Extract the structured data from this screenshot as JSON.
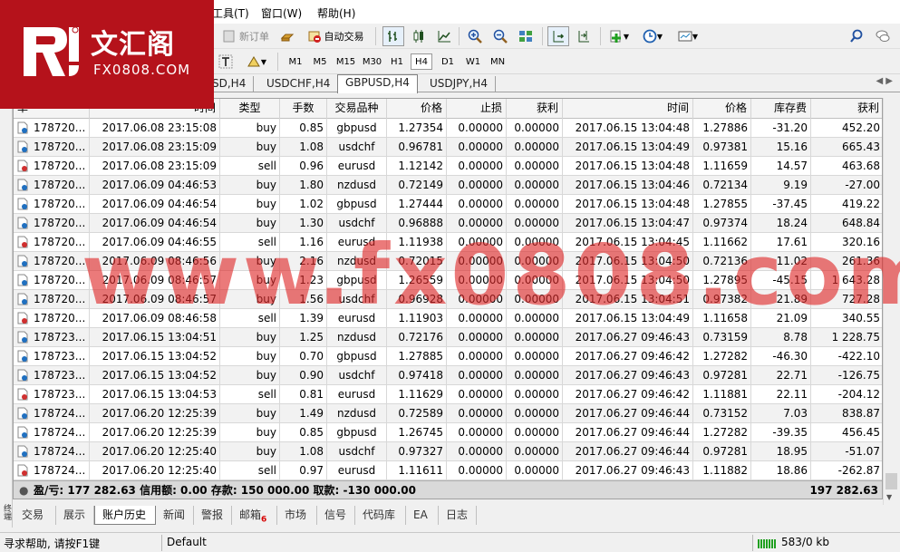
{
  "menu": [
    "工具(T)",
    "窗口(W)",
    "帮助(H)"
  ],
  "toolbar": {
    "new_order": "新订单",
    "auto_trading": "自动交易"
  },
  "timeframes": [
    "M1",
    "M5",
    "M15",
    "M30",
    "H1",
    "H4",
    "D1",
    "W1",
    "MN"
  ],
  "active_timeframe": "H4",
  "logo": {
    "cn": "文汇阁",
    "en": "FX0808.COM"
  },
  "chart_tabs": [
    "SD,H4",
    "USDCHF,H4",
    "GBPUSD,H4",
    "USDJPY,H4"
  ],
  "active_chart_tab": "GBPUSD,H4",
  "table": {
    "headers": [
      "单",
      "时间",
      "类型",
      "手数",
      "交易品种",
      "价格",
      "止损",
      "获利",
      "时间",
      "价格",
      "库存费",
      "获利"
    ],
    "rows": [
      [
        "178720...",
        "2017.06.08 23:15:08",
        "buy",
        "0.85",
        "gbpusd",
        "1.27354",
        "0.00000",
        "0.00000",
        "2017.06.15 13:04:48",
        "1.27886",
        "-31.20",
        "452.20"
      ],
      [
        "178720...",
        "2017.06.08 23:15:09",
        "buy",
        "1.08",
        "usdchf",
        "0.96781",
        "0.00000",
        "0.00000",
        "2017.06.15 13:04:49",
        "0.97381",
        "15.16",
        "665.43"
      ],
      [
        "178720...",
        "2017.06.08 23:15:09",
        "sell",
        "0.96",
        "eurusd",
        "1.12142",
        "0.00000",
        "0.00000",
        "2017.06.15 13:04:48",
        "1.11659",
        "14.57",
        "463.68"
      ],
      [
        "178720...",
        "2017.06.09 04:46:53",
        "buy",
        "1.80",
        "nzdusd",
        "0.72149",
        "0.00000",
        "0.00000",
        "2017.06.15 13:04:46",
        "0.72134",
        "9.19",
        "-27.00"
      ],
      [
        "178720...",
        "2017.06.09 04:46:54",
        "buy",
        "1.02",
        "gbpusd",
        "1.27444",
        "0.00000",
        "0.00000",
        "2017.06.15 13:04:48",
        "1.27855",
        "-37.45",
        "419.22"
      ],
      [
        "178720...",
        "2017.06.09 04:46:54",
        "buy",
        "1.30",
        "usdchf",
        "0.96888",
        "0.00000",
        "0.00000",
        "2017.06.15 13:04:47",
        "0.97374",
        "18.24",
        "648.84"
      ],
      [
        "178720...",
        "2017.06.09 04:46:55",
        "sell",
        "1.16",
        "eurusd",
        "1.11938",
        "0.00000",
        "0.00000",
        "2017.06.15 13:04:45",
        "1.11662",
        "17.61",
        "320.16"
      ],
      [
        "178720...",
        "2017.06.09 08:46:56",
        "buy",
        "2.16",
        "nzdusd",
        "0.72015",
        "0.00000",
        "0.00000",
        "2017.06.15 13:04:50",
        "0.72136",
        "11.02",
        "261.36"
      ],
      [
        "178720...",
        "2017.06.09 08:46:57",
        "buy",
        "1.23",
        "gbpusd",
        "1.26559",
        "0.00000",
        "0.00000",
        "2017.06.15 13:04:50",
        "1.27895",
        "-45.15",
        "1 643.28"
      ],
      [
        "178720...",
        "2017.06.09 08:46:57",
        "buy",
        "1.56",
        "usdchf",
        "0.96928",
        "0.00000",
        "0.00000",
        "2017.06.15 13:04:51",
        "0.97382",
        "21.89",
        "727.28"
      ],
      [
        "178720...",
        "2017.06.09 08:46:58",
        "sell",
        "1.39",
        "eurusd",
        "1.11903",
        "0.00000",
        "0.00000",
        "2017.06.15 13:04:49",
        "1.11658",
        "21.09",
        "340.55"
      ],
      [
        "178723...",
        "2017.06.15 13:04:51",
        "buy",
        "1.25",
        "nzdusd",
        "0.72176",
        "0.00000",
        "0.00000",
        "2017.06.27 09:46:43",
        "0.73159",
        "8.78",
        "1 228.75"
      ],
      [
        "178723...",
        "2017.06.15 13:04:52",
        "buy",
        "0.70",
        "gbpusd",
        "1.27885",
        "0.00000",
        "0.00000",
        "2017.06.27 09:46:42",
        "1.27282",
        "-46.30",
        "-422.10"
      ],
      [
        "178723...",
        "2017.06.15 13:04:52",
        "buy",
        "0.90",
        "usdchf",
        "0.97418",
        "0.00000",
        "0.00000",
        "2017.06.27 09:46:43",
        "0.97281",
        "22.71",
        "-126.75"
      ],
      [
        "178723...",
        "2017.06.15 13:04:53",
        "sell",
        "0.81",
        "eurusd",
        "1.11629",
        "0.00000",
        "0.00000",
        "2017.06.27 09:46:42",
        "1.11881",
        "22.11",
        "-204.12"
      ],
      [
        "178724...",
        "2017.06.20 12:25:39",
        "buy",
        "1.49",
        "nzdusd",
        "0.72589",
        "0.00000",
        "0.00000",
        "2017.06.27 09:46:44",
        "0.73152",
        "7.03",
        "838.87"
      ],
      [
        "178724...",
        "2017.06.20 12:25:39",
        "buy",
        "0.85",
        "gbpusd",
        "1.26745",
        "0.00000",
        "0.00000",
        "2017.06.27 09:46:44",
        "1.27282",
        "-39.35",
        "456.45"
      ],
      [
        "178724...",
        "2017.06.20 12:25:40",
        "buy",
        "1.08",
        "usdchf",
        "0.97327",
        "0.00000",
        "0.00000",
        "2017.06.27 09:46:44",
        "0.97281",
        "18.95",
        "-51.07"
      ],
      [
        "178724...",
        "2017.06.20 12:25:40",
        "sell",
        "0.97",
        "eurusd",
        "1.11611",
        "0.00000",
        "0.00000",
        "2017.06.27 09:46:43",
        "1.11882",
        "18.86",
        "-262.87"
      ]
    ],
    "summary_text": "盈/亏: 177 282.63  信用额: 0.00  存款: 150 000.00  取款: -130 000.00",
    "summary_total": "197 282.63"
  },
  "bottom_tabs": [
    {
      "label": "交易",
      "badge": ""
    },
    {
      "label": "展示",
      "badge": ""
    },
    {
      "label": "账户历史",
      "badge": ""
    },
    {
      "label": "新闻",
      "badge": ""
    },
    {
      "label": "警报",
      "badge": ""
    },
    {
      "label": "邮箱",
      "badge": "6"
    },
    {
      "label": "市场",
      "badge": ""
    },
    {
      "label": "信号",
      "badge": ""
    },
    {
      "label": "代码库",
      "badge": ""
    },
    {
      "label": "EA",
      "badge": ""
    },
    {
      "label": "日志",
      "badge": ""
    }
  ],
  "active_bottom_tab": "账户历史",
  "sidebar_label": "终端",
  "status": {
    "help": "寻求帮助, 请按F1键",
    "profile": "Default",
    "traffic": "583/0 kb"
  },
  "watermark": "www.fx0808.com",
  "colors": {
    "brand_red": "#b5121b",
    "watermark": "#de2828"
  }
}
